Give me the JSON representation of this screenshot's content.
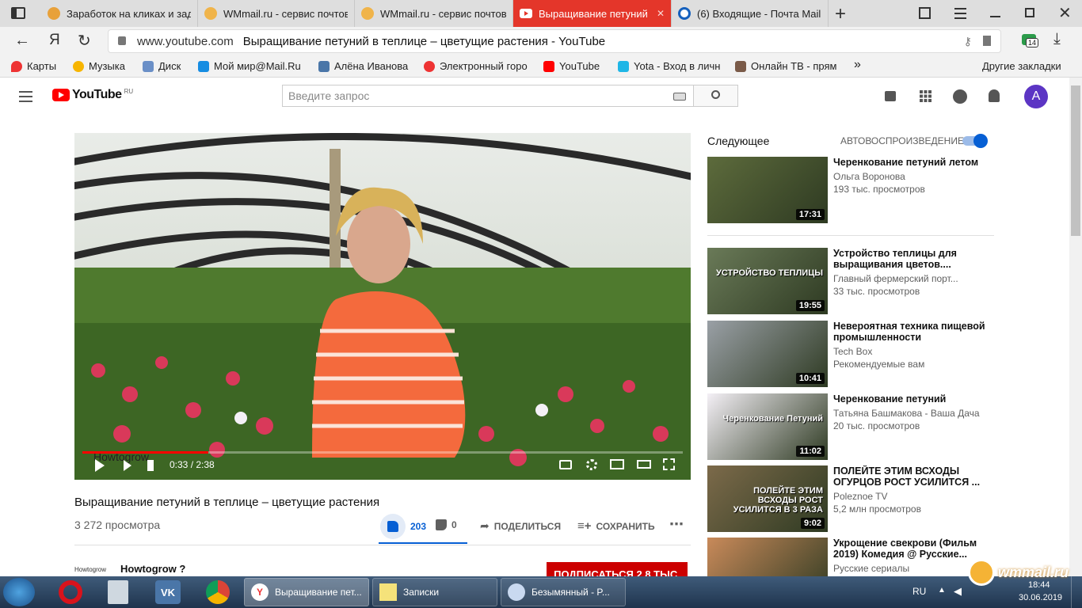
{
  "browser": {
    "tabs": [
      {
        "title": "Заработок на кликах и зад",
        "active": false
      },
      {
        "title": "WMmail.ru - сервис почтов",
        "active": false
      },
      {
        "title": "WMmail.ru - сервис почтов",
        "active": false
      },
      {
        "title": "Выращивание петуний",
        "active": true
      },
      {
        "title": "(6) Входящие - Почта Mail",
        "active": false
      }
    ],
    "url_host": "www.youtube.com",
    "url_title": "Выращивание петуний в теплице – цветущие растения - YouTube",
    "downloads_badge": "14",
    "bookmarks": [
      "Карты",
      "Музыка",
      "Диск",
      "Мой мир@Mail.Ru",
      "Алёна Иванова",
      "Электронный горо",
      "YouTube",
      "Yota - Вход в личн",
      "Онлайн ТВ - прям"
    ],
    "bookmarks_overflow": "»",
    "other_bookmarks": "Другие закладки"
  },
  "youtube": {
    "logo_text": "YouTube",
    "logo_region": "RU",
    "search_placeholder": "Введите запрос",
    "avatar_letter": "A",
    "accent": "#ff0000",
    "player": {
      "watermark": "Howtogrow",
      "time": "0:33 / 2:38",
      "progress": 0.21
    },
    "video": {
      "title": "Выращивание петуний в теплице – цветущие растения",
      "views": "3 272 просмотра",
      "likes": "203",
      "dislikes": "0",
      "share": "ПОДЕЛИТЬСЯ",
      "save": "СОХРАНИТЬ"
    },
    "channel": {
      "name": "Howtogrow ?",
      "subscribe": "ПОДПИСАТЬСЯ 2,8 ТЫС."
    },
    "sidebar": {
      "next_label": "Следующее",
      "autoplay_label": "АВТОВОСПРОИЗВЕДЕНИЕ",
      "autoplay_on": true,
      "items": [
        {
          "title": "Черенкование петуний летом",
          "channel": "Ольга Воронова",
          "meta": "193 тыс. просмотров",
          "duration": "17:31",
          "thumb_color": "#5d6b3c",
          "thumb_text": ""
        },
        {
          "title": "Устройство теплицы для выращивания цветов....",
          "channel": "Главный фермерский порт...",
          "meta": "33 тыс. просмотров",
          "duration": "19:55",
          "thumb_color": "#6a7a58",
          "thumb_text": "УСТРОЙСТВО ТЕПЛИЦЫ"
        },
        {
          "title": "Невероятная техника пищевой промышленности",
          "channel": "Tech Box",
          "meta": "Рекомендуемые вам",
          "duration": "10:41",
          "thumb_color": "#9aa0a6",
          "thumb_text": ""
        },
        {
          "title": "Черенкование петуний",
          "channel": "Татьяна Башмакова - Ваша Дача",
          "meta": "20 тыс. просмотров",
          "duration": "11:02",
          "thumb_color": "#f4f0f6",
          "thumb_text": "Черенкование Петуний"
        },
        {
          "title": "ПОЛЕЙТЕ ЭТИМ ВСХОДЫ ОГУРЦОВ РОСТ УСИЛИТСЯ ...",
          "channel": "Poleznoe TV",
          "meta": "5,2 млн просмотров",
          "duration": "9:02",
          "thumb_color": "#7c6a4a",
          "thumb_text": "ПОЛЕЙТЕ ЭТИМ ВСХОДЫ РОСТ УСИЛИТСЯ В 3 РАЗА"
        },
        {
          "title": "Укрощение свекрови (Фильм 2019) Комедия @ Русские...",
          "channel": "Русские сериалы",
          "meta": "",
          "duration": "",
          "thumb_color": "#c98a5a",
          "thumb_text": ""
        }
      ]
    }
  },
  "taskbar": {
    "tasks": [
      "Выращивание пет...",
      "Записки",
      "Безымянный - P..."
    ],
    "lang": "RU",
    "time": "18:44",
    "date": "30.06.2019",
    "watermark": "wmmail.ru"
  }
}
